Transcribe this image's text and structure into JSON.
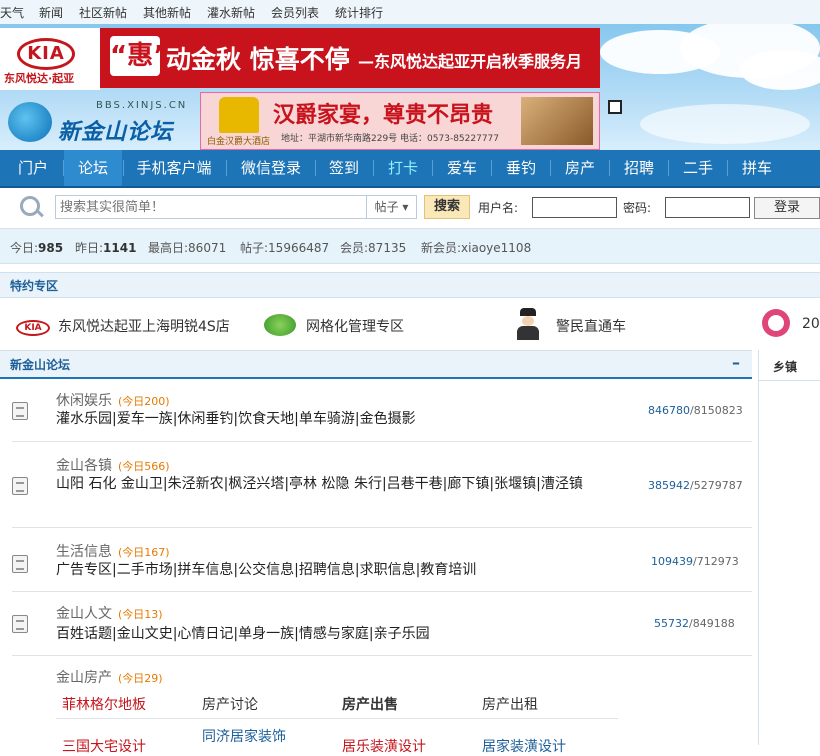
{
  "topnav": {
    "items": [
      "天气",
      "新闻",
      "社区新帖",
      "其他新帖",
      "灌水新帖",
      "会员列表",
      "统计排行"
    ]
  },
  "header": {
    "kia_logo": "KIA",
    "kia_sub": "东风悦达·起亚",
    "banner1": {
      "quote": "“惠”",
      "main": "动金秋 惊喜不停",
      "sub": "—东风悦达起亚开启秋季服务月"
    },
    "forum_logo": {
      "name": "新金山论坛",
      "url": "BBS.XINJS.CN"
    },
    "banner2": {
      "big": "汉爵家宴，尊贵不昂贵",
      "hotel": "白金汉爵大酒店",
      "small": "地址：平湖市新华南路229号 电话：0573-85227777"
    }
  },
  "mainnav": {
    "items": [
      "门户",
      "论坛",
      "手机客户端",
      "微信登录",
      "签到",
      "打卡",
      "爱车",
      "垂钓",
      "房产",
      "招聘",
      "二手",
      "拼车"
    ]
  },
  "search": {
    "placeholder": "搜索其实很简单！",
    "type": "帖子",
    "button": "搜索",
    "username_label": "用户名:",
    "password_label": "密码:",
    "login": "登录"
  },
  "stats": {
    "today_label": "今日:",
    "today": "985",
    "yesterday_label": "昨日:",
    "yesterday": "1141",
    "max_label": "最高日:",
    "max": "86071",
    "posts_label": "帖子:",
    "posts": "15966487",
    "members_label": "会员:",
    "members": "87135",
    "newmember_label": "新会员:",
    "newmember": "xiaoye1108"
  },
  "special": {
    "title": "特约专区",
    "items": [
      "东风悦达起亚上海明锐4S店",
      "网格化管理专区",
      "警民直通车",
      "20"
    ]
  },
  "forum": {
    "title": "新金山论坛",
    "collapse": "–",
    "side_title": "乡镇",
    "sections": [
      {
        "name": "休闲娱乐",
        "today": "(今日200)",
        "subs": "灌水乐园|爱车一族|休闲垂钓|饮食天地|单车骑游|金色摄影",
        "threads": "846780",
        "posts": "/8150823"
      },
      {
        "name": "金山各镇",
        "today": "(今日566)",
        "subs": "山阳 石化 金山卫|朱泾新农|枫泾兴塔|亭林 松隐 朱行|吕巷干巷|廊下镇|张堰镇|漕泾镇",
        "threads": "385942",
        "posts": "/5279787"
      },
      {
        "name": "生活信息",
        "today": "(今日167)",
        "subs": "广告专区|二手市场|拼车信息|公交信息|招聘信息|求职信息|教育培训",
        "threads": "109439",
        "posts": "/712973"
      },
      {
        "name": "金山人文",
        "today": "(今日13)",
        "subs": "百姓话题|金山文史|心情日记|单身一族|情感与家庭|亲子乐园",
        "threads": "55732",
        "posts": "/849188"
      },
      {
        "name": "金山房产",
        "today": "(今日29)"
      }
    ],
    "house_subs": [
      "菲林格尔地板",
      "房产讨论",
      "房产出售",
      "房产出租",
      "三国大宅设计",
      "同济居家装饰",
      "居乐装潢设计",
      "居家装潢设计"
    ]
  },
  "colors": {
    "nav_blue": "#1d74b6",
    "kia_red": "#c4161c",
    "today_orange": "#e67a00"
  }
}
